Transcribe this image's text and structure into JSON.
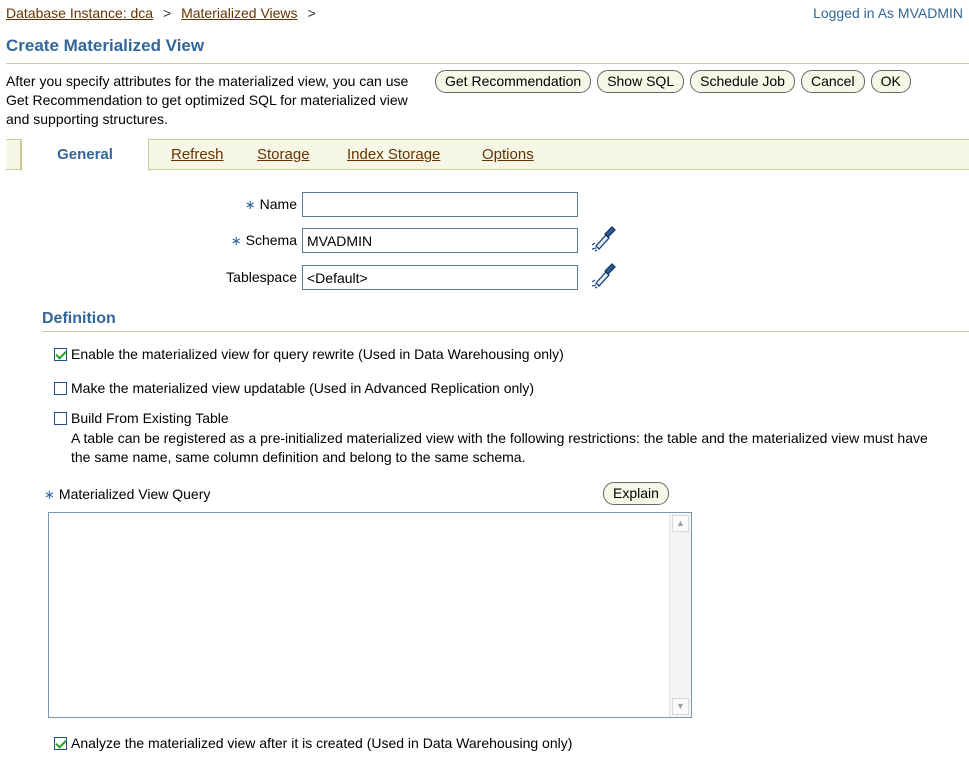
{
  "breadcrumb": {
    "item1": "Database Instance: dca",
    "sep1": ">",
    "item2": "Materialized Views",
    "sep2": ">"
  },
  "logged_in": "Logged in As MVADMIN",
  "page_title": "Create Materialized View",
  "description": "After you specify attributes for the materialized view, you can use Get Recommendation to get optimized SQL for materialized view and supporting structures.",
  "buttons": {
    "get_recommendation": "Get Recommendation",
    "show_sql": "Show SQL",
    "schedule_job": "Schedule Job",
    "cancel": "Cancel",
    "ok": "OK",
    "explain": "Explain"
  },
  "tabs": {
    "general": "General",
    "refresh": "Refresh",
    "storage": "Storage",
    "index_storage": "Index Storage",
    "options": "Options"
  },
  "form": {
    "required_mark": "∗",
    "name_label": "Name",
    "name_value": "",
    "schema_label": "Schema",
    "schema_value": "MVADMIN",
    "tablespace_label": "Tablespace",
    "tablespace_value": "<Default>"
  },
  "definition": {
    "heading": "Definition",
    "query_rewrite": {
      "label": "Enable the materialized view for query rewrite (Used in Data Warehousing only)",
      "checked": true
    },
    "updatable": {
      "label": "Make the materialized view updatable (Used in Advanced Replication only)",
      "checked": false
    },
    "build_existing": {
      "label": "Build From Existing Table",
      "checked": false
    },
    "build_help": "A table can be registered as a pre-initialized materialized view with the following restrictions: the table and the materialized view must have the same name, same column definition and belong to the same schema.",
    "query_label": "Materialized View Query",
    "query_value": "",
    "analyze": {
      "label": "Analyze the materialized view after it is created (Used in Data Warehousing only)",
      "checked": true
    }
  },
  "colors": {
    "header_blue": "#336699",
    "link_brown": "#663300",
    "tab_bar": "#f7f7e7",
    "rule": "#cccc99"
  },
  "icons": {
    "schema_search": "flashlight-icon",
    "tablespace_search": "flashlight-icon"
  }
}
